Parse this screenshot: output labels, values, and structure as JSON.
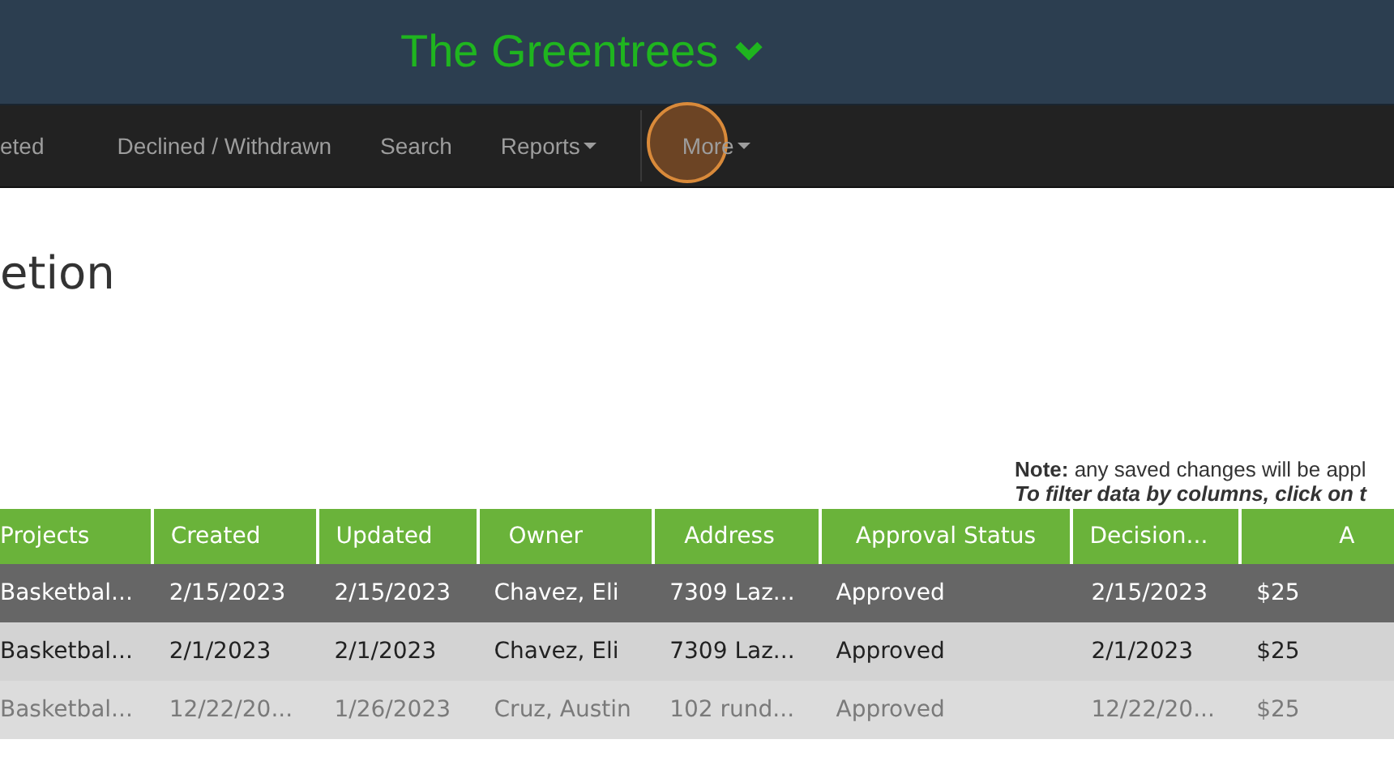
{
  "header": {
    "title": "The Greentrees"
  },
  "nav": {
    "items": [
      {
        "label": "eted",
        "dropdown": false,
        "selected": false
      },
      {
        "label": "Declined / Withdrawn",
        "dropdown": false,
        "selected": false
      },
      {
        "label": "Search",
        "dropdown": false,
        "selected": false
      },
      {
        "label": "Reports",
        "dropdown": true,
        "selected": false
      },
      {
        "label": "More",
        "dropdown": true,
        "selected": true
      }
    ]
  },
  "page_heading": "etion",
  "notes": [
    "**Note:** any saved changes will be appl",
    "To filter data by columns, click on t"
  ],
  "table": {
    "columns": [
      "Projects",
      "Created",
      "Updated",
      "Owner",
      "Address",
      "Approval Status",
      "Decision...",
      "A"
    ],
    "rows": [
      {
        "selected": true,
        "faded": false,
        "cells": [
          "Basketbal...",
          "2/15/2023",
          "2/15/2023",
          "Chavez, Eli",
          "7309 Laz...",
          "Approved",
          "2/15/2023",
          "$25"
        ]
      },
      {
        "selected": false,
        "faded": false,
        "cells": [
          "Basketbal...",
          "2/1/2023",
          "2/1/2023",
          "Chavez, Eli",
          "7309 Laz...",
          "Approved",
          "2/1/2023",
          "$25"
        ]
      },
      {
        "selected": false,
        "faded": true,
        "cells": [
          "Basketbal...",
          "12/22/20...",
          "1/26/2023",
          "Cruz, Austin",
          "102 rund...",
          "Approved",
          "12/22/20...",
          "$25"
        ]
      }
    ]
  }
}
